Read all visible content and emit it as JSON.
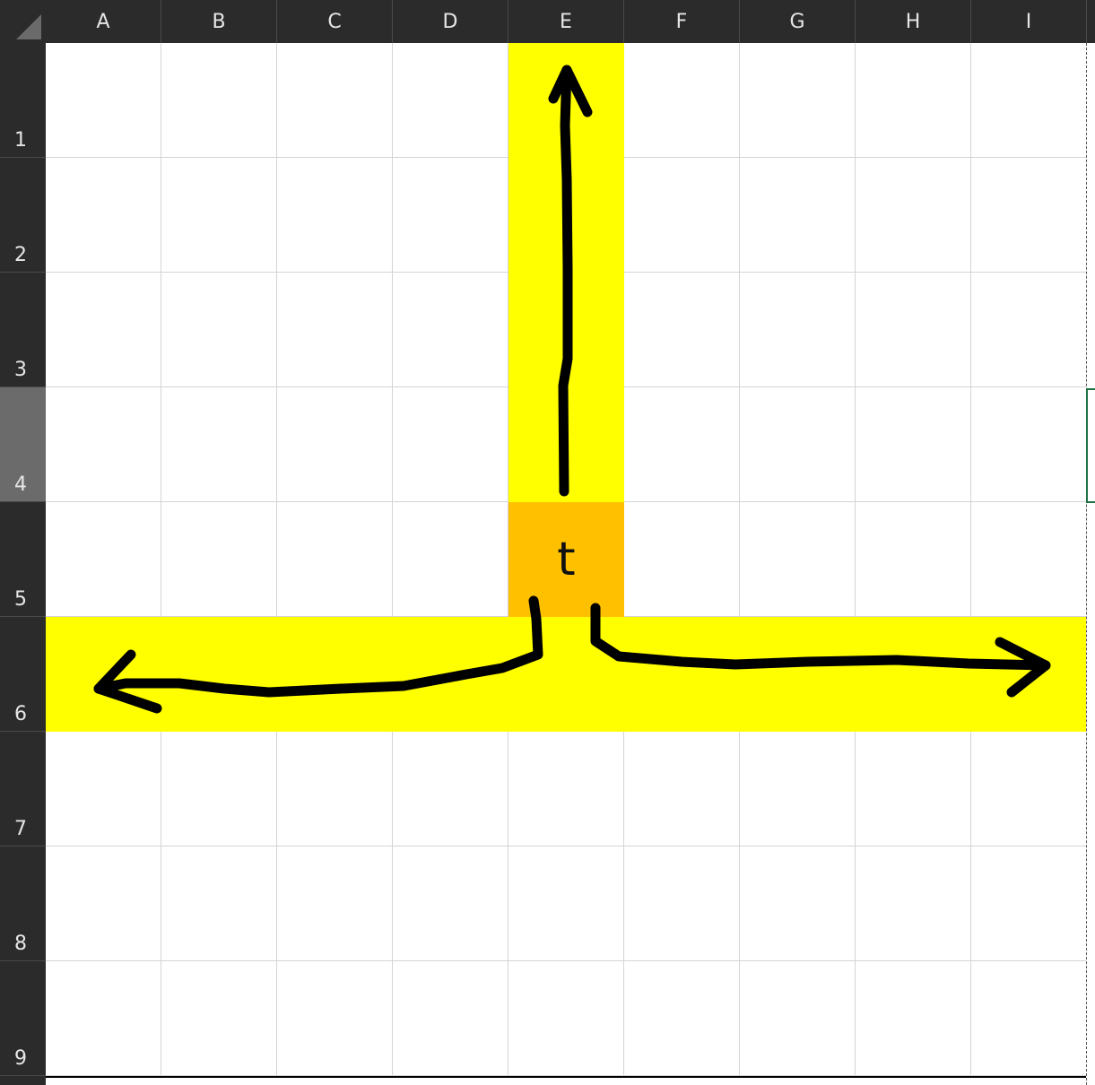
{
  "columns": [
    "A",
    "B",
    "C",
    "D",
    "E",
    "F",
    "G",
    "H",
    "I"
  ],
  "rows": [
    "1",
    "2",
    "3",
    "4",
    "5",
    "6",
    "7",
    "8",
    "9"
  ],
  "selected_row": "4",
  "cells": [
    {
      "ref": "E5",
      "text": "t"
    }
  ],
  "colors": {
    "highlight_yellow": "#ffff00",
    "highlight_orange": "#ffc000",
    "header_bg": "#2b2b2b",
    "header_text": "#e6e6e6",
    "gridline": "#d4d4d4",
    "ink": "#000000"
  }
}
